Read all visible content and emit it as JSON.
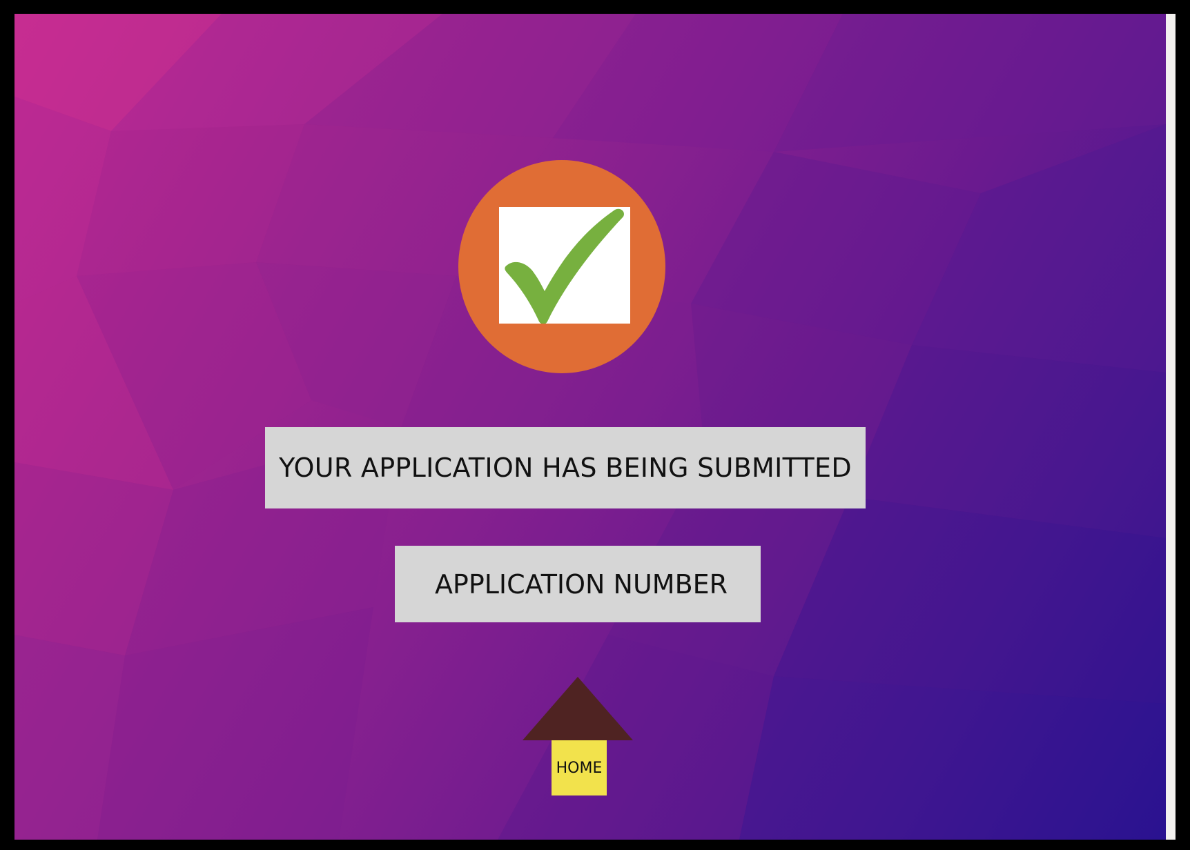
{
  "colors": {
    "frame": "#000000",
    "badge": "#e06d35",
    "checkmark": "#77b03f",
    "panel": "#d6d6d6",
    "arrow_head": "#4f2322",
    "home_button": "#f2e24c",
    "background_start": "#c52a93",
    "background_end": "#2a1290"
  },
  "status_icon": {
    "icon": "checkmark-icon"
  },
  "messages": {
    "submitted": "YOUR APPLICATION HAS BEING SUBMITTED",
    "application_number": "APPLICATION NUMBER"
  },
  "home": {
    "label": "HOME",
    "icon": "up-arrow-icon"
  }
}
